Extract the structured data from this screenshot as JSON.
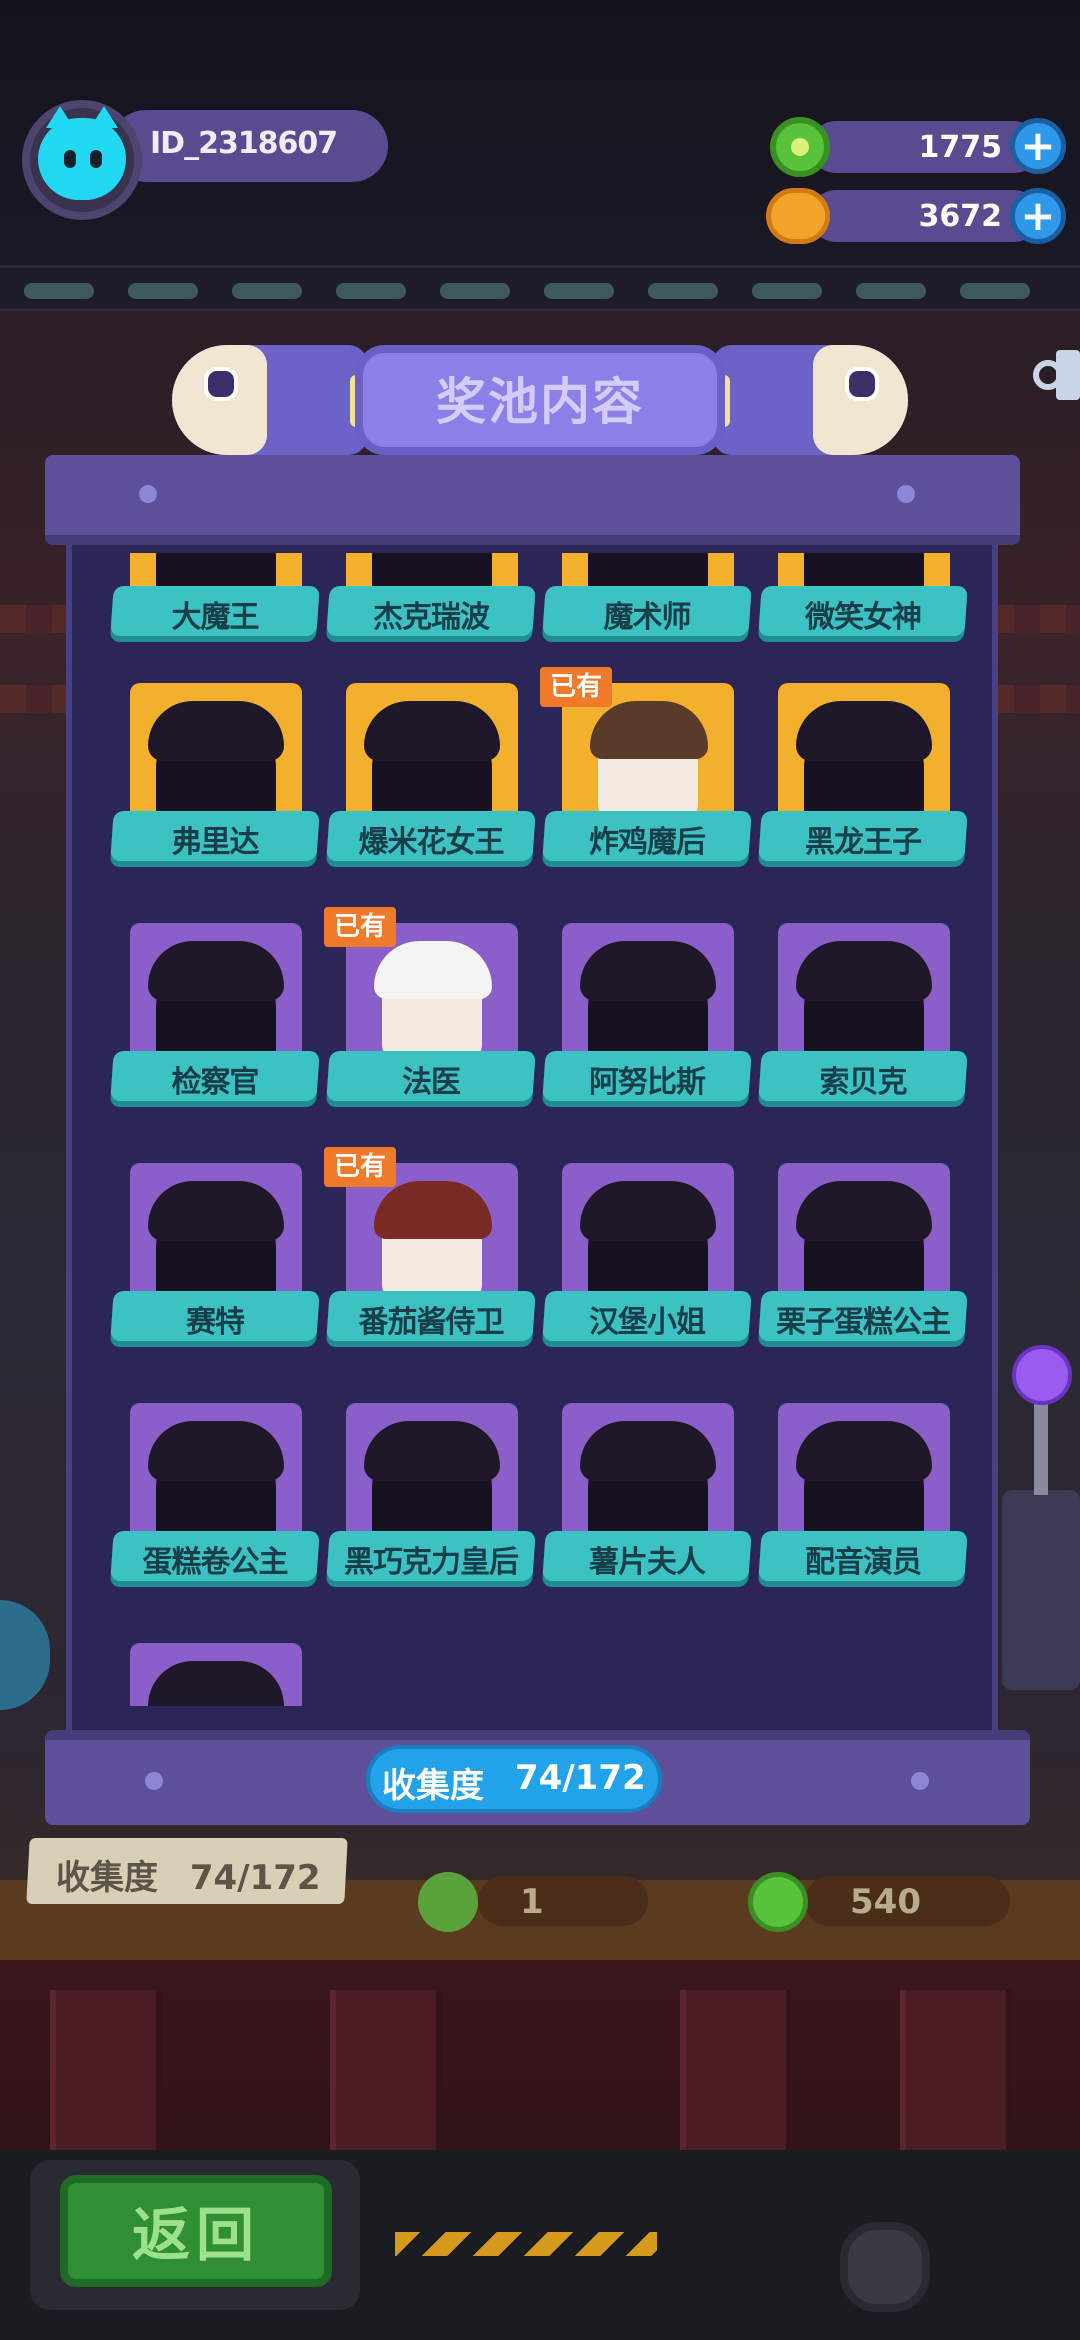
{
  "player": {
    "id": "ID_2318607"
  },
  "currencies": [
    {
      "icon": "donut-icon",
      "value": "1775"
    },
    {
      "icon": "planet-coin-icon",
      "value": "3672"
    }
  ],
  "panel": {
    "title": "奖池内容",
    "collection_label": "收集度",
    "collection_count": "74/172"
  },
  "characters": [
    {
      "name": "大魔王",
      "frame": "gold",
      "owned": false
    },
    {
      "name": "杰克瑞波",
      "frame": "gold",
      "owned": false
    },
    {
      "name": "魔术师",
      "frame": "gold",
      "owned": false
    },
    {
      "name": "微笑女神",
      "frame": "gold",
      "owned": false
    },
    {
      "name": "弗里达",
      "frame": "gold",
      "owned": false
    },
    {
      "name": "爆米花女王",
      "frame": "gold",
      "owned": false
    },
    {
      "name": "炸鸡魔后",
      "frame": "gold",
      "owned": true
    },
    {
      "name": "黑龙王子",
      "frame": "gold",
      "owned": false
    },
    {
      "name": "检察官",
      "frame": "purple",
      "owned": false
    },
    {
      "name": "法医",
      "frame": "purple",
      "owned": true
    },
    {
      "name": "阿努比斯",
      "frame": "purple",
      "owned": false
    },
    {
      "name": "索贝克",
      "frame": "purple",
      "owned": false
    },
    {
      "name": "赛特",
      "frame": "purple",
      "owned": false
    },
    {
      "name": "番茄酱侍卫",
      "frame": "purple",
      "owned": true
    },
    {
      "name": "汉堡小姐",
      "frame": "purple",
      "owned": false
    },
    {
      "name": "栗子蛋糕公主",
      "frame": "purple",
      "owned": false
    },
    {
      "name": "蛋糕卷公主",
      "frame": "purple",
      "owned": false
    },
    {
      "name": "黑巧克力皇后",
      "frame": "purple",
      "owned": false
    },
    {
      "name": "薯片夫人",
      "frame": "purple",
      "owned": false
    },
    {
      "name": "配音演员",
      "frame": "purple",
      "owned": false
    },
    {
      "name": "",
      "frame": "purple",
      "owned": false
    }
  ],
  "owned_badge": "已有",
  "background": {
    "collection_label": "收集度",
    "collection_count": "74/172",
    "cost_1": "1",
    "cost_2": "540"
  },
  "back_button": {
    "label": "返回"
  },
  "colors": {
    "panel": "#2c2658",
    "frame_gold": "#f2b02c",
    "frame_purple": "#8a5fc9",
    "name_bar": "#3cc2c2",
    "owned_badge": "#f07a2a",
    "collection_pill": "#22a2e8",
    "back_button": "#2e8f34"
  }
}
